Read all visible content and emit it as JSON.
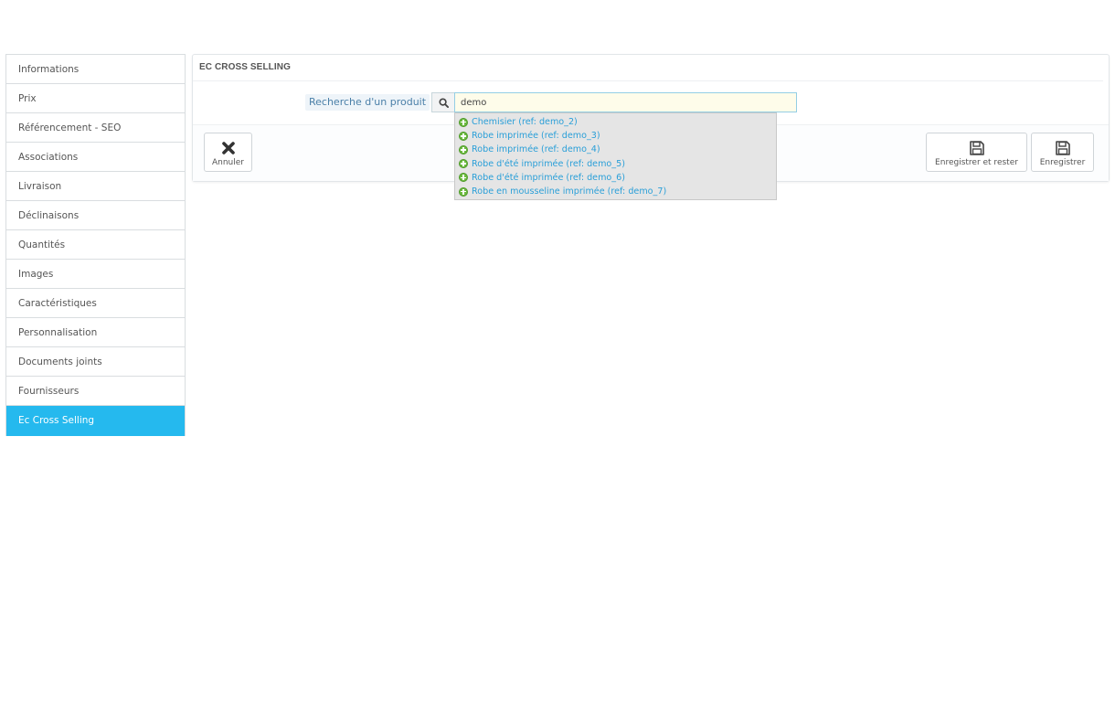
{
  "sidebar": {
    "items": [
      {
        "label": "Informations"
      },
      {
        "label": "Prix"
      },
      {
        "label": "Référencement - SEO"
      },
      {
        "label": "Associations"
      },
      {
        "label": "Livraison"
      },
      {
        "label": "Déclinaisons"
      },
      {
        "label": "Quantités"
      },
      {
        "label": "Images"
      },
      {
        "label": "Caractéristiques"
      },
      {
        "label": "Personnalisation"
      },
      {
        "label": "Documents joints"
      },
      {
        "label": "Fournisseurs"
      },
      {
        "label": "Ec Cross Selling"
      }
    ],
    "active": "Ec Cross Selling",
    "active_color": "#25b9ee"
  },
  "panel": {
    "title": "EC CROSS SELLING",
    "search": {
      "label": "Recherche d'un produit",
      "value": "demo",
      "icon": "search-icon"
    },
    "suggestions": [
      {
        "label": "Chemisier (ref: demo_2)"
      },
      {
        "label": "Robe imprimée (ref: demo_3)"
      },
      {
        "label": "Robe imprimée (ref: demo_4)"
      },
      {
        "label": "Robe d'été imprimée (ref: demo_5)"
      },
      {
        "label": "Robe d'été imprimée (ref: demo_6)"
      },
      {
        "label": "Robe en mousseline imprimée (ref: demo_7)"
      }
    ],
    "footer": {
      "cancel_label": "Annuler",
      "save_stay_label": "Enregistrer et rester",
      "save_label": "Enregistrer"
    }
  }
}
